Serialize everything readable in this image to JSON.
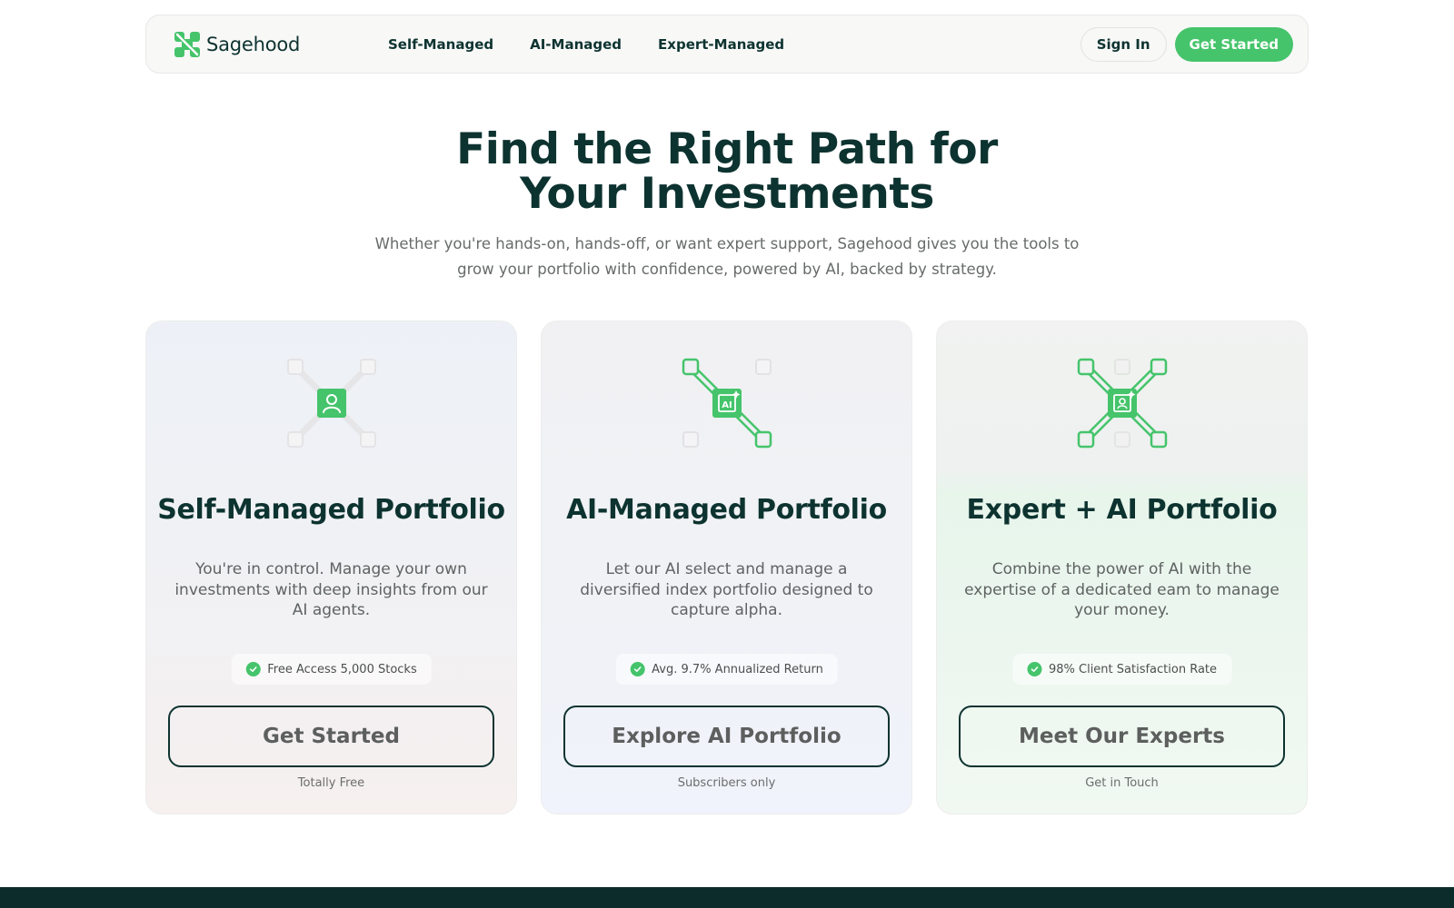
{
  "brand": {
    "name": "Sagehood",
    "accent": "#45c46b",
    "dark": "#0d3330"
  },
  "nav": {
    "links": [
      "Self-Managed",
      "AI-Managed",
      "Expert-Managed"
    ],
    "sign_in": "Sign In",
    "get_started": "Get Started"
  },
  "hero": {
    "title_line1": "Find the Right Path for",
    "title_line2": "Your Investments",
    "subtitle": "Whether you're hands-on, hands-off, or want expert support, Sagehood gives you the tools to grow your portfolio with confidence, powered by AI, backed by strategy."
  },
  "cards": [
    {
      "icon": "person-network-icon",
      "title": "Self-Managed Portfolio",
      "description": "You're in control. Manage your own investments with deep insights from our AI agents.",
      "badge": "Free Access 5,000 Stocks",
      "button": "Get Started",
      "note": "Totally Free"
    },
    {
      "icon": "ai-network-icon",
      "title": "AI-Managed Portfolio",
      "description": "Let our AI select and manage a diversified index portfolio designed to capture alpha.",
      "badge": "Avg. 9.7% Annualized Return",
      "button": "Explore AI Portfolio",
      "note": "Subscribers only"
    },
    {
      "icon": "expert-ai-network-icon",
      "title": "Expert + AI Portfolio",
      "description": "Combine the power of AI with the expertise of a dedicated eam to manage your money.",
      "badge": "98% Client Satisfaction Rate",
      "button": "Meet Our Experts",
      "note": "Get in Touch"
    }
  ]
}
